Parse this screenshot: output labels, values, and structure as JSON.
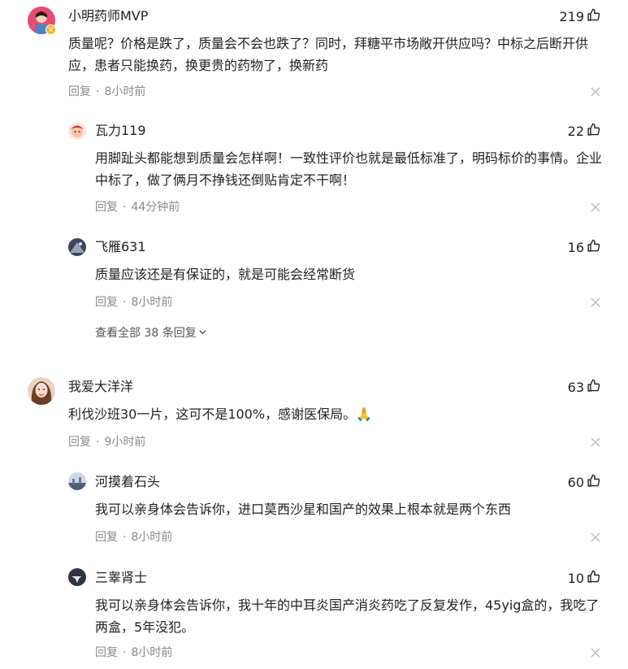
{
  "comments": [
    {
      "name": "小明药师MVP",
      "likes": "219",
      "text": "质量呢？价格是跌了，质量会不会也跌了？同时，拜糖平市场敞开供应吗？中标之后断开供应，患者只能换药，换更贵的药物了，换新药",
      "reply_label": "回复",
      "time": "8小时前",
      "badge": "V",
      "replies": [
        {
          "name": "瓦力119",
          "likes": "22",
          "text": "用脚趾头都能想到质量会怎样啊！一致性评价也就是最低标准了，明码标价的事情。企业中标了，做了俩月不挣钱还倒贴肯定不干啊！",
          "reply_label": "回复",
          "time": "44分钟前"
        },
        {
          "name": "飞雁631",
          "likes": "16",
          "text": "质量应该还是有保证的，就是可能会经常断货",
          "reply_label": "回复",
          "time": "8小时前"
        }
      ],
      "view_all": "查看全部 38 条回复"
    },
    {
      "name": "我爱大洋洋",
      "likes": "63",
      "text": "利伐沙班30一片，这可不是100%，感谢医保局。🙏",
      "reply_label": "回复",
      "time": "9小时前",
      "replies": [
        {
          "name": "河摸着石头",
          "likes": "60",
          "text": "我可以亲身体会告诉你，进口莫西沙星和国产的效果上根本就是两个东西",
          "reply_label": "回复",
          "time": "8小时前"
        },
        {
          "name": "三睾肾士",
          "likes": "10",
          "text": "我可以亲身体会告诉你，我十年的中耳炎国产消炎药吃了反复发作，45yig盒的，我吃了两盒，5年没犯。",
          "reply_label": "回复",
          "time": "8小时前"
        }
      ]
    }
  ],
  "colors": {
    "text": "#222222",
    "meta": "#8a8a8a",
    "badge": "#f2b72e"
  },
  "icons": {
    "like": "thumbs-up-icon",
    "close": "close-icon",
    "expand": "chevron-down-icon"
  }
}
